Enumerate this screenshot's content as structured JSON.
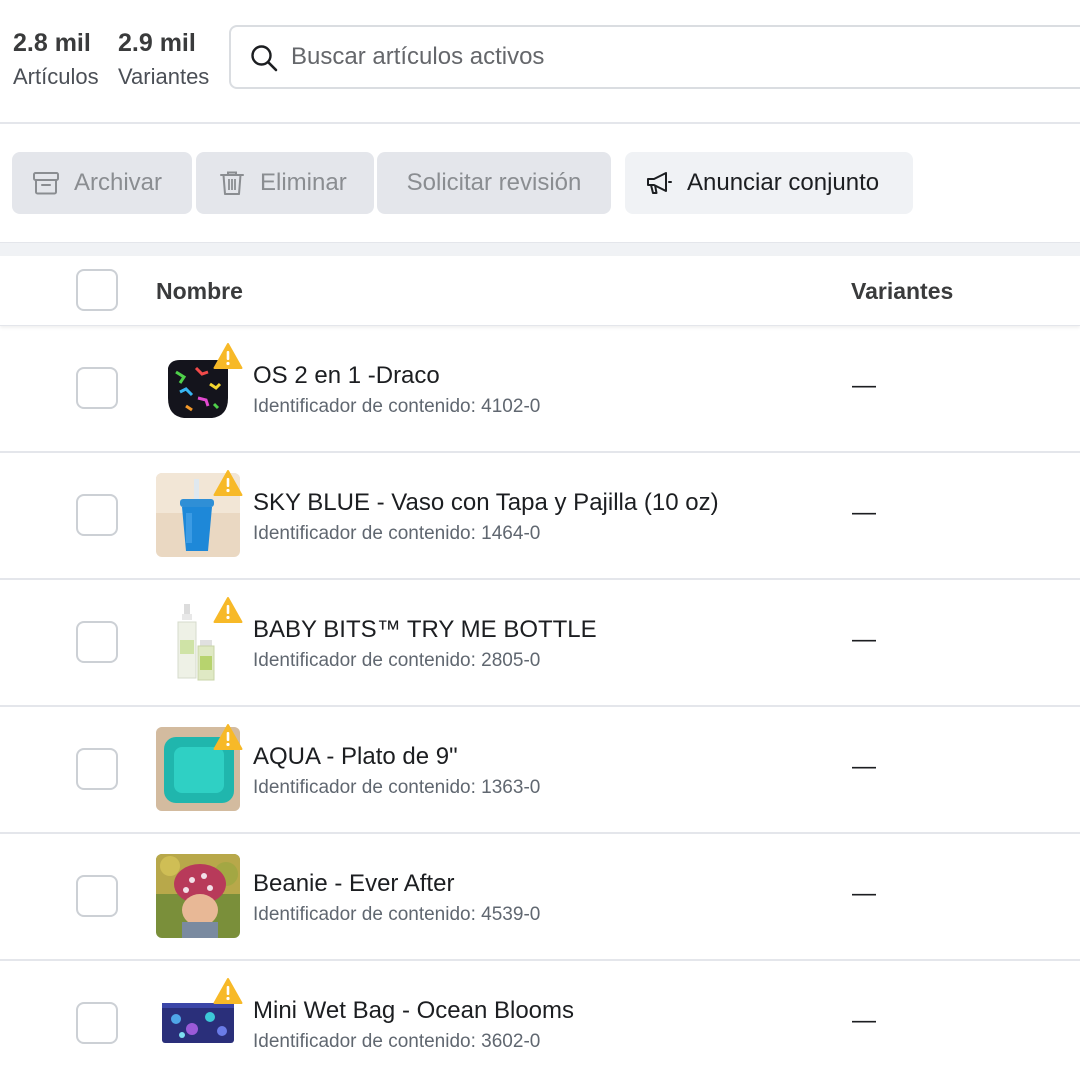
{
  "stats": {
    "articles_count": "2.8 mil",
    "articles_label": "Artículos",
    "variants_count": "2.9 mil",
    "variants_label": "Variantes"
  },
  "search": {
    "icon": "search-icon",
    "placeholder": "Buscar artículos activos",
    "value": ""
  },
  "toolbar": {
    "archive": {
      "label": "Archivar",
      "icon": "archive-icon",
      "enabled": false
    },
    "delete": {
      "label": "Eliminar",
      "icon": "trash-icon",
      "enabled": false
    },
    "review": {
      "label": "Solicitar revisión",
      "enabled": false
    },
    "announce": {
      "label": "Anunciar conjunto",
      "icon": "megaphone-icon",
      "enabled": true
    }
  },
  "table": {
    "columns": {
      "name": "Nombre",
      "variants": "Variantes"
    },
    "id_prefix": "Identificador de contenido:",
    "rows": [
      {
        "title": "OS 2 en 1 -Draco",
        "content_id": "4102-0",
        "variants": "—",
        "warning": true,
        "thumb": "cloth-diaper-dino-print"
      },
      {
        "title": "SKY BLUE - Vaso con Tapa y Pajilla (10 oz)",
        "content_id": "1464-0",
        "variants": "—",
        "warning": true,
        "thumb": "blue-straw-cup"
      },
      {
        "title": "BABY BITS™ TRY ME BOTTLE",
        "content_id": "2805-0",
        "variants": "—",
        "warning": true,
        "thumb": "spray-bottles"
      },
      {
        "title": "AQUA - Plato de 9\"",
        "content_id": "1363-0",
        "variants": "—",
        "warning": true,
        "thumb": "aqua-plate"
      },
      {
        "title": "Beanie - Ever After",
        "content_id": "4539-0",
        "variants": "—",
        "warning": false,
        "thumb": "child-beanie-photo"
      },
      {
        "title": "Mini Wet Bag - Ocean Blooms",
        "content_id": "3602-0",
        "variants": "—",
        "warning": true,
        "thumb": "wet-bag-ocean"
      }
    ]
  },
  "colors": {
    "warning": "#f7b928",
    "button_disabled_bg": "#e4e6eb",
    "button_bg": "#f0f2f5",
    "border": "#e4e6eb"
  }
}
